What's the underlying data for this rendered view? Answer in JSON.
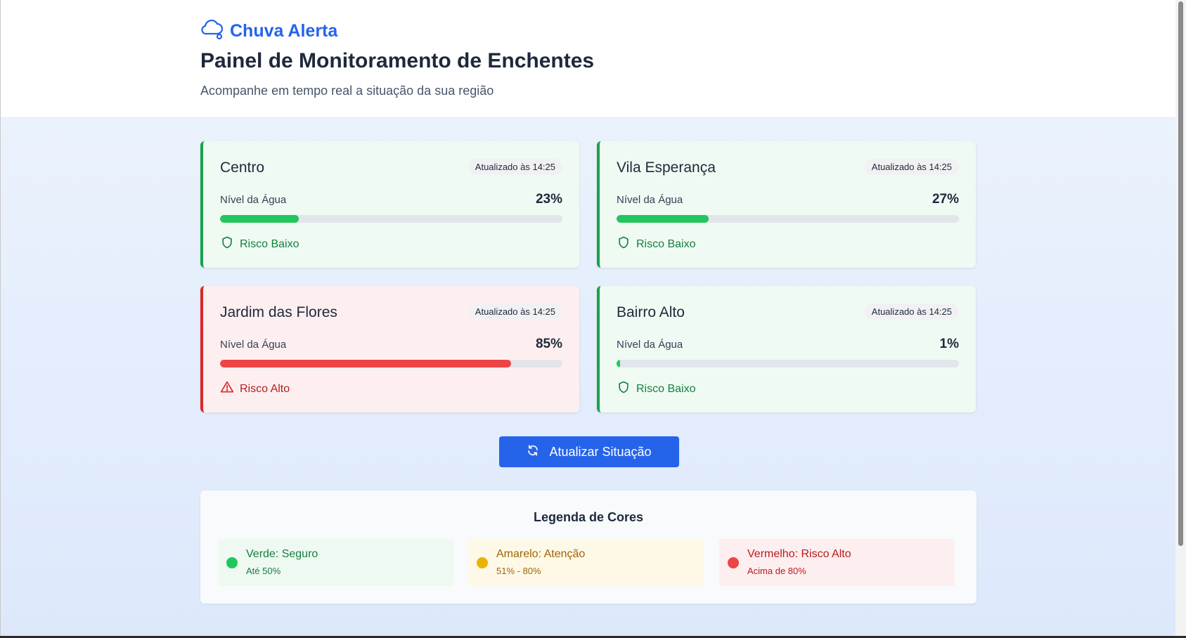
{
  "brand": {
    "name": "Chuva Alerta",
    "icon": "cloud-rain-icon",
    "color": "#2563eb"
  },
  "header": {
    "title": "Painel de Monitoramento de Enchentes",
    "subtitle": "Acompanhe em tempo real a situação da sua região"
  },
  "regions": [
    {
      "name": "Centro",
      "updated": "Atualizado às 14:25",
      "level_label": "Nível da Água",
      "level": 23,
      "level_text": "23%",
      "risk": "Risco Baixo",
      "status": "safe",
      "icon": "shield-icon"
    },
    {
      "name": "Vila Esperança",
      "updated": "Atualizado às 14:25",
      "level_label": "Nível da Água",
      "level": 27,
      "level_text": "27%",
      "risk": "Risco Baixo",
      "status": "safe",
      "icon": "shield-icon"
    },
    {
      "name": "Jardim das Flores",
      "updated": "Atualizado às 14:25",
      "level_label": "Nível da Água",
      "level": 85,
      "level_text": "85%",
      "risk": "Risco Alto",
      "status": "danger",
      "icon": "warning-triangle-icon"
    },
    {
      "name": "Bairro Alto",
      "updated": "Atualizado às 14:25",
      "level_label": "Nível da Água",
      "level": 1,
      "level_text": "1%",
      "risk": "Risco Baixo",
      "status": "safe",
      "icon": "shield-icon"
    }
  ],
  "update_button": {
    "label": "Atualizar Situação",
    "icon": "refresh-icon"
  },
  "legend": {
    "title": "Legenda de Cores",
    "items": [
      {
        "name": "Verde: Seguro",
        "range": "Até 50%",
        "color": "#22c55e"
      },
      {
        "name": "Amarelo: Atenção",
        "range": "51% - 80%",
        "color": "#eab308"
      },
      {
        "name": "Vermelho: Risco Alto",
        "range": "Acima de 80%",
        "color": "#ef4444"
      }
    ]
  },
  "colors": {
    "safe": "#22c55e",
    "danger": "#ef4444",
    "accent": "#2563eb"
  }
}
